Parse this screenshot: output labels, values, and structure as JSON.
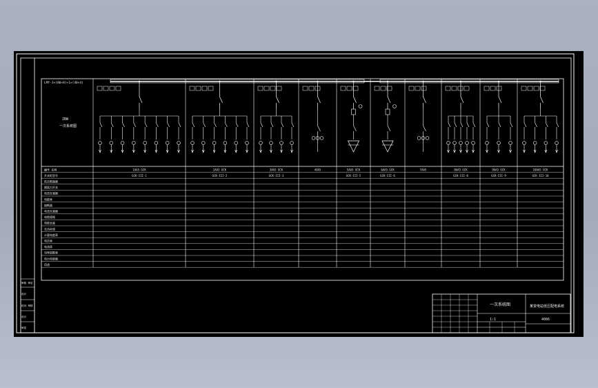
{
  "drawing": {
    "busbar_label": "LMY-3×(80×8)+1×(40×4)",
    "left_title": [
      "ZBW",
      "一次系统图"
    ],
    "row_labels": [
      "编号 名称",
      "开关柜型号",
      "低压断路器",
      "隔离刀开关",
      "电流互感器",
      "电能表",
      "熔断器",
      "电流互感器",
      "电缆规格",
      "电缆长度",
      "无功补偿",
      "计量电度表",
      "电压表",
      "电流表",
      "功率因数表",
      "电力电容器",
      "用途"
    ],
    "columns": [
      {
        "name": "1AA5 GCK",
        "model": "GCK-III-1"
      },
      {
        "name": "2AA5 GCK",
        "model": "GCK-III-2"
      },
      {
        "name": "3AA5 GCK",
        "model": "GCK-III-3"
      },
      {
        "name": "4AA5",
        "model": ""
      },
      {
        "name": "5AA5 GCK",
        "model": "GCK-III-5"
      },
      {
        "name": "6AA5 GCK",
        "model": "GCK-III-6"
      },
      {
        "name": "7AA5",
        "model": ""
      },
      {
        "name": "8AA5 GCK",
        "model": "GCK-III-8"
      },
      {
        "name": "9AA5 GCK",
        "model": "GCK-III-9"
      },
      {
        "name": "10AA5 GCK",
        "model": "GCK-III-10"
      }
    ],
    "left_strip": [
      "审核 审定",
      "设计",
      "校对 审核",
      "设计",
      "审定"
    ],
    "title_block": {
      "drawing_title": "一次系统图",
      "project_name": "某变电站低压配电系统",
      "drawing_no": "4086",
      "scale": "1:1"
    }
  }
}
